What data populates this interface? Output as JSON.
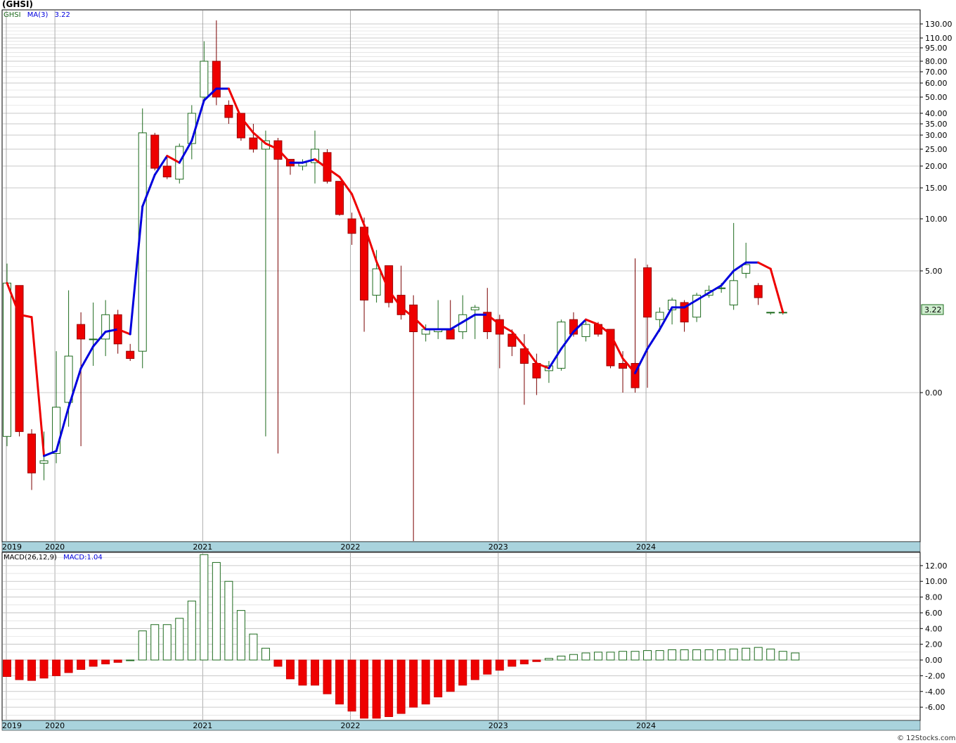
{
  "title": "(GHSI)",
  "price_legend": {
    "ticker": "GHSI",
    "ma_label": "MA(3)",
    "ma_value": "3.22"
  },
  "macd_legend": {
    "label": "MACD(26,12,9)",
    "value": "MACD:1.04"
  },
  "last_price_label": "3.22",
  "copyright": "© 12Stocks.com",
  "colors": {
    "up": "#1e6b1e",
    "down": "#ee0000",
    "ma_up": "#0000dd",
    "ma_down": "#ee0000",
    "axis_bar": "#a9d3dd",
    "grid": "#d6d6d6"
  },
  "chart_data": [
    {
      "type": "candlestick",
      "title": "(GHSI)",
      "scale": "log-like",
      "y_ticks": [
        "130.00",
        "110.00",
        "95.00",
        "80.00",
        "70.00",
        "60.00",
        "50.00",
        "40.00",
        "35.00",
        "30.00",
        "25.00",
        "20.00",
        "15.00",
        "10.00",
        "5.00",
        "0.00"
      ],
      "y_tick_values": [
        130,
        110,
        95,
        80,
        70,
        60,
        50,
        40,
        35,
        30,
        25,
        20,
        15,
        10,
        5,
        0
      ],
      "x_labels": [
        "2019",
        "2020",
        "2021",
        "2022",
        "2023",
        "2024"
      ],
      "x_label_index": [
        0,
        4,
        16,
        28,
        40,
        52
      ],
      "candles": [
        {
          "o": -1.8,
          "h": 5.7,
          "l": -2.2,
          "c": 4.5
        },
        {
          "o": 4.4,
          "h": 4.4,
          "l": -1.8,
          "c": -1.6
        },
        {
          "o": -1.7,
          "h": -1.5,
          "l": -4.0,
          "c": -3.3
        },
        {
          "o": -2.9,
          "h": -1.6,
          "l": -3.6,
          "c": -2.8
        },
        {
          "o": -2.5,
          "h": 1.7,
          "l": -2.9,
          "c": -0.6
        },
        {
          "o": -0.4,
          "h": 4.2,
          "l": -1.4,
          "c": 1.5
        },
        {
          "o": 2.8,
          "h": 3.3,
          "l": -2.2,
          "c": 2.2
        },
        {
          "o": 2.2,
          "h": 3.7,
          "l": 1.1,
          "c": 2.2
        },
        {
          "o": 2.2,
          "h": 3.8,
          "l": 1.5,
          "c": 3.2
        },
        {
          "o": 3.2,
          "h": 3.4,
          "l": 1.6,
          "c": 2.0
        },
        {
          "o": 1.7,
          "h": 2.0,
          "l": 1.3,
          "c": 1.4
        },
        {
          "o": 1.7,
          "h": 43,
          "l": 1.0,
          "c": 31
        },
        {
          "o": 30,
          "h": 31,
          "l": 19,
          "c": 19.5
        },
        {
          "o": 20,
          "h": 23,
          "l": 17,
          "c": 17.5
        },
        {
          "o": 17,
          "h": 27,
          "l": 16,
          "c": 26
        },
        {
          "o": 27,
          "h": 45,
          "l": 22,
          "c": 40
        },
        {
          "o": 50,
          "h": 105,
          "l": 47,
          "c": 80
        },
        {
          "o": 80,
          "h": 135,
          "l": 45,
          "c": 50
        },
        {
          "o": 45,
          "h": 48,
          "l": 35,
          "c": 38
        },
        {
          "o": 40,
          "h": 40,
          "l": 28,
          "c": 29
        },
        {
          "o": 29,
          "h": 35,
          "l": 24,
          "c": 25
        },
        {
          "o": 25,
          "h": 32,
          "l": -1.8,
          "c": 28
        },
        {
          "o": 28,
          "h": 29,
          "l": -2.5,
          "c": 22
        },
        {
          "o": 22,
          "h": 22,
          "l": 18,
          "c": 20
        },
        {
          "o": 20,
          "h": 22,
          "l": 19,
          "c": 21
        },
        {
          "o": 21,
          "h": 32,
          "l": 16,
          "c": 25
        },
        {
          "o": 24,
          "h": 25,
          "l": 16,
          "c": 16.5
        },
        {
          "o": 16.5,
          "h": 16.5,
          "l": 10.5,
          "c": 10.7
        },
        {
          "o": 10,
          "h": 11,
          "l": 7.5,
          "c": 8.6
        },
        {
          "o": 9.2,
          "h": 10.2,
          "l": 2.5,
          "c": 3.8
        },
        {
          "o": 4.0,
          "h": 7.0,
          "l": 3.7,
          "c": 5.2
        },
        {
          "o": 5.5,
          "h": 5.5,
          "l": 3.5,
          "c": 3.7
        },
        {
          "o": 4.0,
          "h": 5.5,
          "l": 3.0,
          "c": 3.2
        },
        {
          "o": 3.6,
          "h": 4.0,
          "l": -50,
          "c": 2.5
        },
        {
          "o": 2.4,
          "h": 2.8,
          "l": 2.1,
          "c": 2.6
        },
        {
          "o": 2.5,
          "h": 3.8,
          "l": 2.2,
          "c": 2.6
        },
        {
          "o": 2.6,
          "h": 3.8,
          "l": 2.2,
          "c": 2.2
        },
        {
          "o": 2.5,
          "h": 4.0,
          "l": 2.2,
          "c": 3.2
        },
        {
          "o": 3.4,
          "h": 3.6,
          "l": 2.2,
          "c": 3.5
        },
        {
          "o": 3.3,
          "h": 4.3,
          "l": 2.2,
          "c": 2.5
        },
        {
          "o": 3.0,
          "h": 3.2,
          "l": 1.0,
          "c": 2.4
        },
        {
          "o": 2.4,
          "h": 2.6,
          "l": 1.5,
          "c": 1.9
        },
        {
          "o": 1.8,
          "h": 2.4,
          "l": -0.5,
          "c": 1.2
        },
        {
          "o": 1.2,
          "h": 1.6,
          "l": -0.1,
          "c": 0.6
        },
        {
          "o": 0.9,
          "h": 1.3,
          "l": 0.4,
          "c": 1.1
        },
        {
          "o": 1.0,
          "h": 3.0,
          "l": 0.9,
          "c": 2.9
        },
        {
          "o": 3.0,
          "h": 3.3,
          "l": 2.3,
          "c": 2.4
        },
        {
          "o": 2.3,
          "h": 3.0,
          "l": 2.1,
          "c": 2.8
        },
        {
          "o": 2.8,
          "h": 2.9,
          "l": 2.3,
          "c": 2.4
        },
        {
          "o": 2.6,
          "h": 2.6,
          "l": 1.0,
          "c": 1.1
        },
        {
          "o": 1.2,
          "h": 1.7,
          "l": 0.0,
          "c": 1.0
        },
        {
          "o": 1.2,
          "h": 6.2,
          "l": 0.0,
          "c": 0.2
        },
        {
          "o": 5.3,
          "h": 5.6,
          "l": 0.2,
          "c": 3.1
        },
        {
          "o": 3.0,
          "h": 3.5,
          "l": 2.5,
          "c": 3.3
        },
        {
          "o": 3.4,
          "h": 3.9,
          "l": 2.8,
          "c": 3.8
        },
        {
          "o": 3.7,
          "h": 3.8,
          "l": 2.5,
          "c": 2.9
        },
        {
          "o": 3.1,
          "h": 4.1,
          "l": 2.9,
          "c": 4.0
        },
        {
          "o": 4.0,
          "h": 4.4,
          "l": 3.9,
          "c": 4.2
        },
        {
          "o": 4.3,
          "h": 4.5,
          "l": 4.1,
          "c": 4.3
        },
        {
          "o": 3.6,
          "h": 9.6,
          "l": 3.4,
          "c": 4.6
        },
        {
          "o": 4.9,
          "h": 7.7,
          "l": 4.7,
          "c": 5.6
        },
        {
          "o": 4.4,
          "h": 4.5,
          "l": 3.6,
          "c": 3.9
        },
        {
          "o": 3.3,
          "h": 3.3,
          "l": 3.2,
          "c": 3.3
        },
        {
          "o": 3.3,
          "h": 3.3,
          "l": 3.2,
          "c": 3.3
        }
      ],
      "series": [
        {
          "name": "MA(3)",
          "values": [
            4.5,
            3.2,
            3.1,
            -2.6,
            -2.4,
            -0.6,
            1.0,
            1.9,
            2.5,
            2.6,
            2.4,
            12,
            18,
            23,
            21,
            28,
            48,
            56,
            56,
            38,
            31,
            27,
            25,
            21,
            21,
            22,
            19.5,
            17.5,
            14,
            9.4,
            5.9,
            4.2,
            3.5,
            3.1,
            2.6,
            2.6,
            2.6,
            2.9,
            3.2,
            3.2,
            2.8,
            2.5,
            1.9,
            1.2,
            1.0,
            1.8,
            2.5,
            3.0,
            2.8,
            2.4,
            1.4,
            0.8,
            1.8,
            2.6,
            3.5,
            3.5,
            3.8,
            4.1,
            4.4,
            5.0,
            5.8,
            5.8,
            5.2,
            3.3
          ]
        }
      ]
    },
    {
      "type": "bar",
      "title": "MACD(26,12,9)",
      "y_ticks": [
        "12.00",
        "10.00",
        "8.00",
        "6.00",
        "4.00",
        "2.00",
        "0.00",
        "-2.00",
        "-4.00",
        "-6.00"
      ],
      "y_tick_values": [
        12,
        10,
        8,
        6,
        4,
        2,
        0,
        -2,
        -4,
        -6
      ],
      "ylim": [
        -7.6,
        13.6
      ],
      "x_labels": [
        "2019",
        "2020",
        "2021",
        "2022",
        "2023",
        "2024"
      ],
      "x_label_index": [
        0,
        4,
        16,
        28,
        40,
        52
      ],
      "values": [
        -2.1,
        -2.5,
        -2.6,
        -2.3,
        -2.0,
        -1.6,
        -1.2,
        -0.8,
        -0.5,
        -0.3,
        0.0,
        3.7,
        4.5,
        4.5,
        5.3,
        7.5,
        13.4,
        12.4,
        10.0,
        6.3,
        3.3,
        1.5,
        -0.8,
        -2.4,
        -3.2,
        -3.2,
        -4.3,
        -5.6,
        -6.5,
        -7.4,
        -7.4,
        -7.2,
        -6.8,
        -6.0,
        -5.6,
        -4.7,
        -4.0,
        -3.2,
        -2.5,
        -1.8,
        -1.3,
        -0.8,
        -0.5,
        -0.2,
        0.2,
        0.5,
        0.7,
        0.9,
        1.0,
        1.0,
        1.1,
        1.1,
        1.2,
        1.2,
        1.3,
        1.3,
        1.3,
        1.3,
        1.3,
        1.4,
        1.5,
        1.6,
        1.4,
        1.1,
        0.9
      ]
    }
  ]
}
